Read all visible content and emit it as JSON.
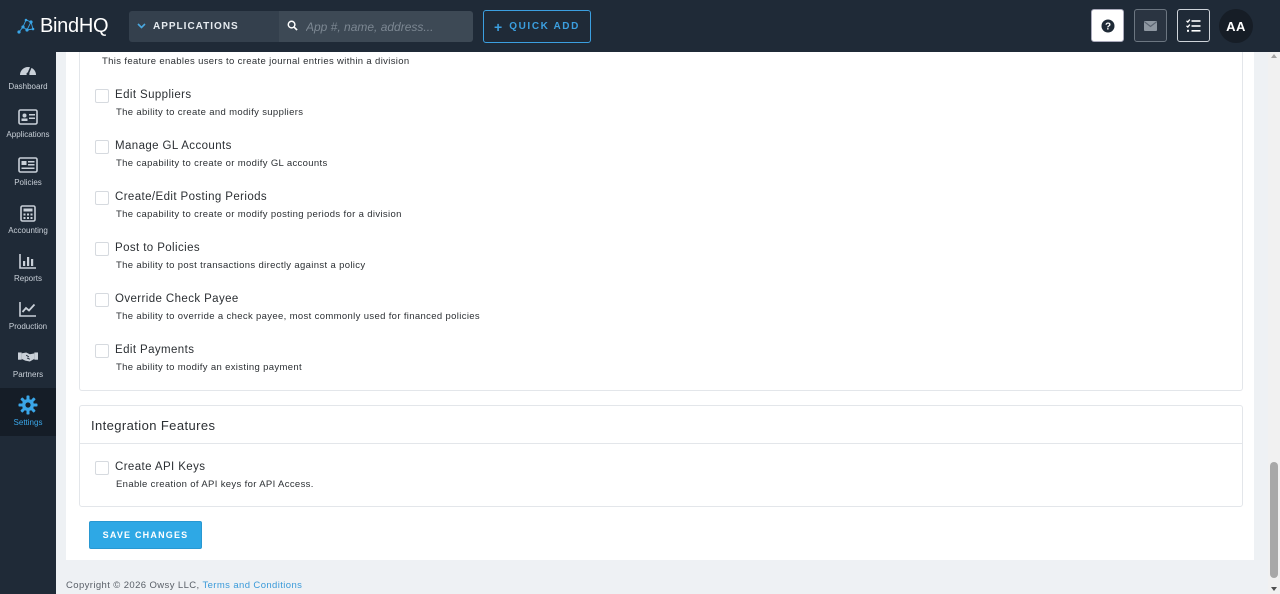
{
  "brand": {
    "name": "BindHQ"
  },
  "header": {
    "app_selector": "APPLICATIONS",
    "search_placeholder": "App #, name, address...",
    "quick_add_label": "QUICK ADD",
    "avatar_initials": "AA"
  },
  "sidebar": {
    "items": [
      {
        "label": "Dashboard",
        "icon": "gauge-icon"
      },
      {
        "label": "Applications",
        "icon": "id-card-icon"
      },
      {
        "label": "Policies",
        "icon": "newspaper-icon"
      },
      {
        "label": "Accounting",
        "icon": "calculator-icon"
      },
      {
        "label": "Reports",
        "icon": "bar-chart-icon"
      },
      {
        "label": "Production",
        "icon": "line-chart-icon"
      },
      {
        "label": "Partners",
        "icon": "handshake-icon"
      },
      {
        "label": "Settings",
        "icon": "gear-icon",
        "active": true
      }
    ]
  },
  "accounting_panel": {
    "top_description": "This feature enables users to create journal entries within a division",
    "permissions": [
      {
        "name": "Edit Suppliers",
        "description": "The ability to create and modify suppliers",
        "checked": false
      },
      {
        "name": "Manage GL Accounts",
        "description": "The capability to create or modify GL accounts",
        "checked": false
      },
      {
        "name": "Create/Edit Posting Periods",
        "description": "The capability to create or modify posting periods for a division",
        "checked": false
      },
      {
        "name": "Post to Policies",
        "description": "The ability to post transactions directly against a policy",
        "checked": false
      },
      {
        "name": "Override Check Payee",
        "description": "The ability to override a check payee, most commonly used for financed policies",
        "checked": false
      },
      {
        "name": "Edit Payments",
        "description": "The ability to modify an existing payment",
        "checked": false
      }
    ]
  },
  "integration_panel": {
    "title": "Integration Features",
    "permissions": [
      {
        "name": "Create API Keys",
        "description": "Enable creation of API keys for API Access.",
        "checked": false
      }
    ]
  },
  "actions": {
    "save_label": "SAVE CHANGES"
  },
  "footer": {
    "copyright": "Copyright © 2026 Owsy LLC, ",
    "terms_link": "Terms and Conditions"
  },
  "colors": {
    "topbar": "#1f2a37",
    "accent": "#2ea8e5",
    "active_nav": "#3aa6e8"
  }
}
